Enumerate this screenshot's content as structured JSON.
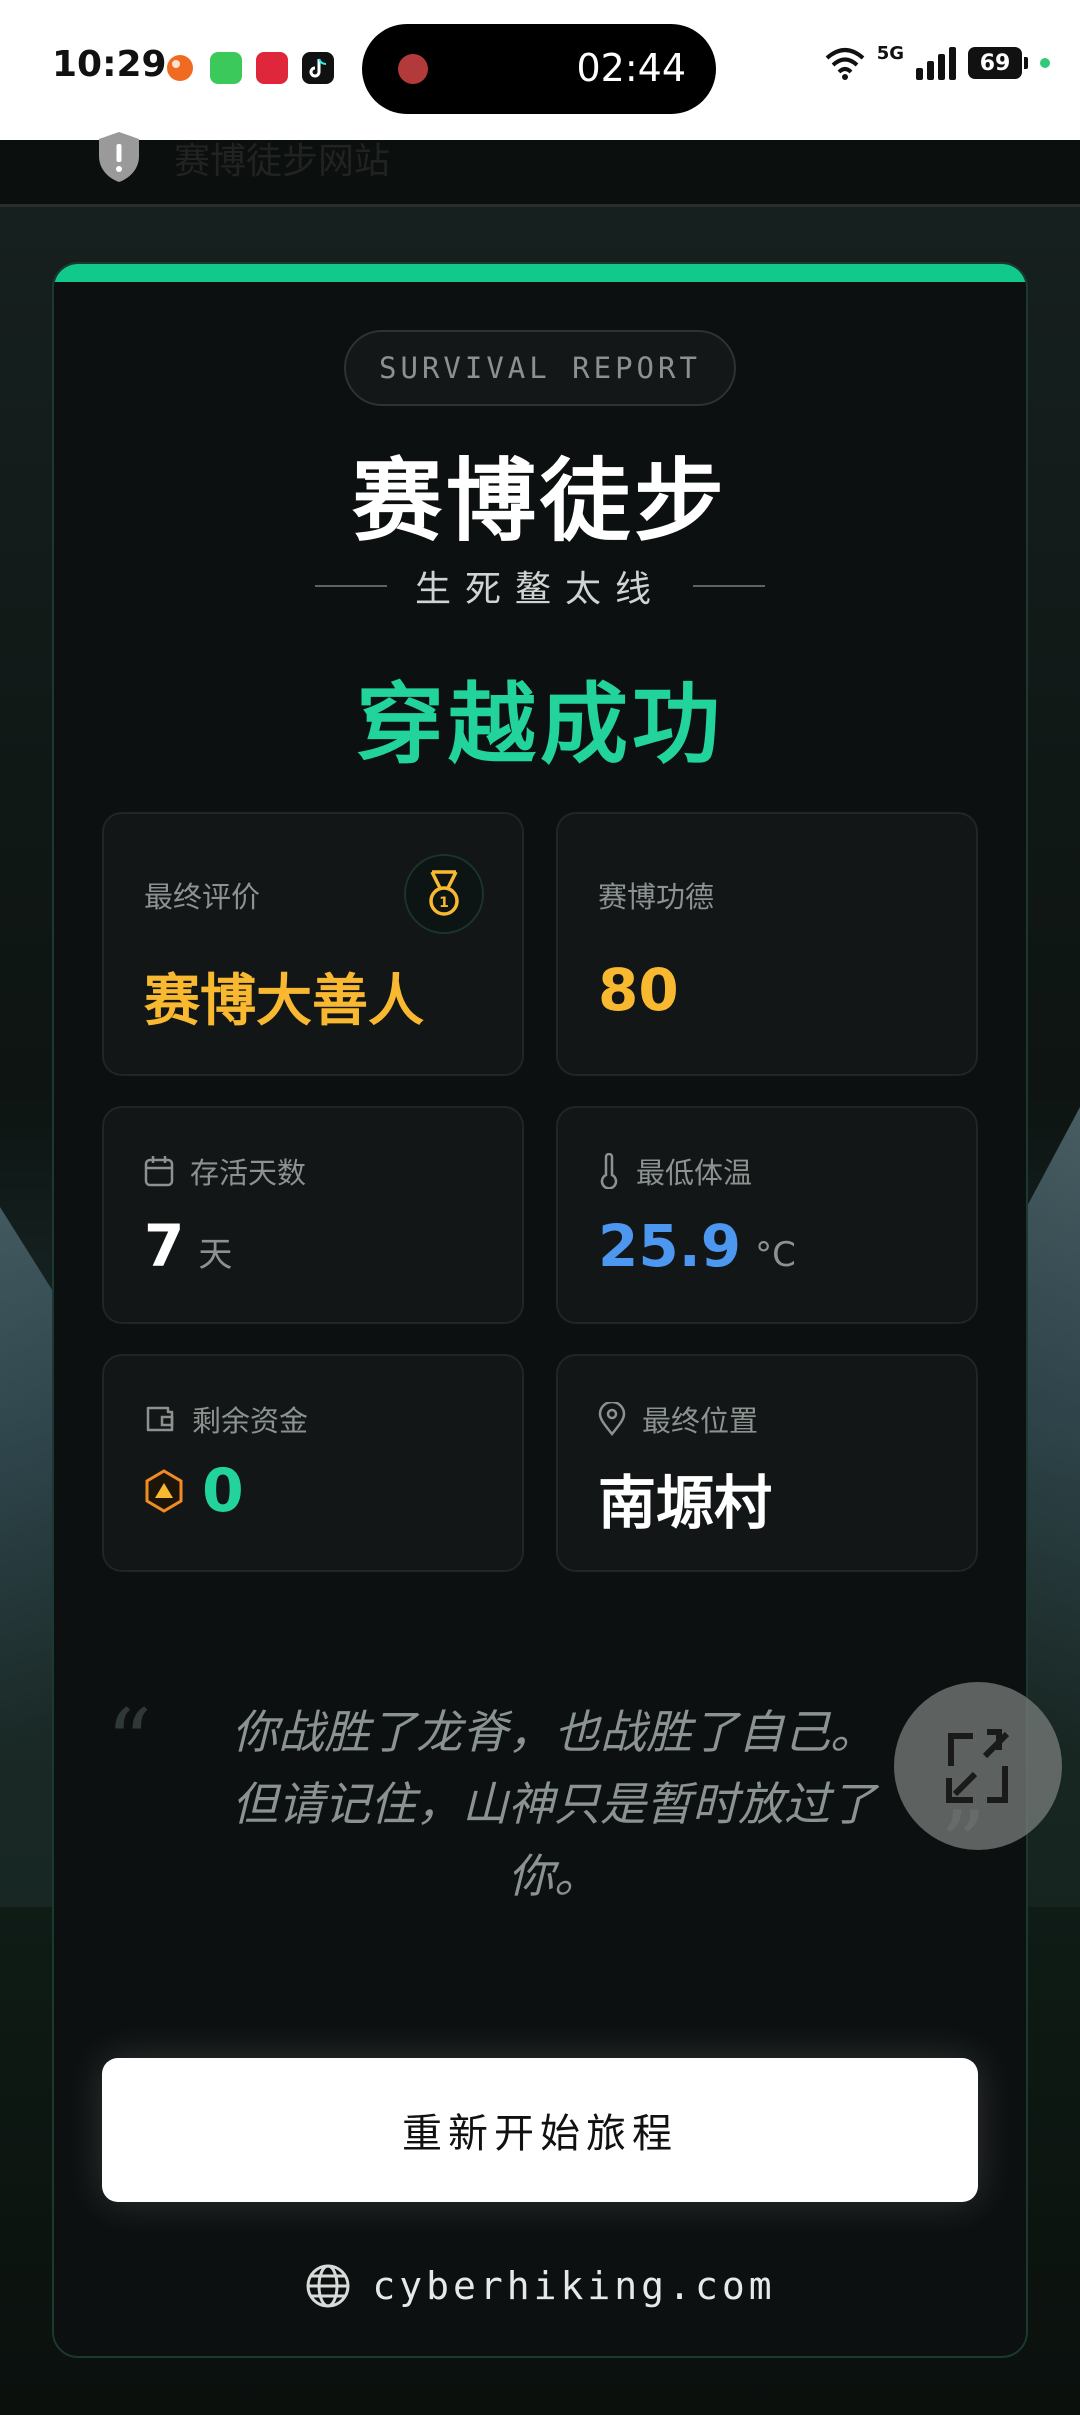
{
  "status_bar": {
    "time": "10:29",
    "recording_timer": "02:44",
    "network": "5G",
    "battery": "69"
  },
  "browser": {
    "site_title": "赛博徒步网站"
  },
  "report": {
    "pill": "SURVIVAL REPORT",
    "title": "赛博徒步",
    "subtitle": "生死鳌太线",
    "result": "穿越成功"
  },
  "stats": {
    "rating": {
      "label": "最终评价",
      "value": "赛博大善人"
    },
    "merit": {
      "label": "赛博功德",
      "value": "80"
    },
    "days": {
      "label": "存活天数",
      "value": "7",
      "unit": "天"
    },
    "temp": {
      "label": "最低体温",
      "value": "25.9",
      "unit": "°C"
    },
    "funds": {
      "label": "剩余资金",
      "value": "0"
    },
    "location": {
      "label": "最终位置",
      "value": "南塬村"
    }
  },
  "quote": {
    "line1": "你战胜了龙脊，也战胜了自己。",
    "line2": "但请记住，山神只是暂时放过了",
    "line3": "你。"
  },
  "actions": {
    "restart_label": "重新开始旅程"
  },
  "footer": {
    "domain": "cyberhiking.com"
  },
  "colors": {
    "accent": "#10c98a",
    "gold": "#f8b931",
    "blue": "#4c97f0",
    "bg": "#0d1010"
  }
}
